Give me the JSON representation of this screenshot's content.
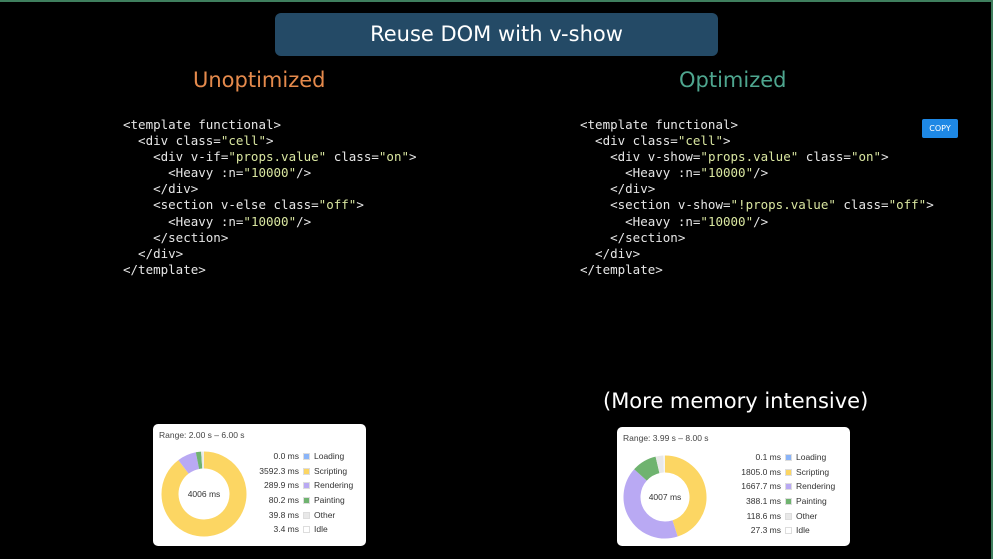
{
  "slide": {
    "title": "Reuse DOM with v-show",
    "left_heading": "Unoptimized",
    "right_heading": "Optimized",
    "copy_label": "COPY",
    "note": "(More memory intensive)"
  },
  "code_left": [
    "<template functional>",
    "  <div class=\"cell\">",
    "    <div v-if=\"props.value\" class=\"on\">",
    "      <Heavy :n=\"10000\"/>",
    "    </div>",
    "    <section v-else class=\"off\">",
    "      <Heavy :n=\"10000\"/>",
    "    </section>",
    "  </div>",
    "</template>"
  ],
  "code_right": [
    "<template functional>",
    "  <div class=\"cell\">",
    "    <div v-show=\"props.value\" class=\"on\">",
    "      <Heavy :n=\"10000\"/>",
    "    </div>",
    "    <section v-show=\"!props.value\" class=\"off\">",
    "      <Heavy :n=\"10000\"/>",
    "    </section>",
    "  </div>",
    "</template>"
  ],
  "perf_left": {
    "range": "Range: 2.00 s – 6.00 s",
    "total": "4006 ms",
    "rows": [
      {
        "value": "0.0 ms",
        "label": "Loading",
        "ms": 0.0,
        "color": "#8ab4f8"
      },
      {
        "value": "3592.3 ms",
        "label": "Scripting",
        "ms": 3592.3,
        "color": "#fcd663"
      },
      {
        "value": "289.9 ms",
        "label": "Rendering",
        "ms": 289.9,
        "color": "#b9a9f3"
      },
      {
        "value": "80.2 ms",
        "label": "Painting",
        "ms": 80.2,
        "color": "#6fb36f"
      },
      {
        "value": "39.8 ms",
        "label": "Other",
        "ms": 39.8,
        "color": "#e8e8e8"
      },
      {
        "value": "3.4 ms",
        "label": "Idle",
        "ms": 3.4,
        "color": "#ffffff"
      }
    ]
  },
  "perf_right": {
    "range": "Range: 3.99 s – 8.00 s",
    "total": "4007 ms",
    "rows": [
      {
        "value": "0.1 ms",
        "label": "Loading",
        "ms": 0.1,
        "color": "#8ab4f8"
      },
      {
        "value": "1805.0 ms",
        "label": "Scripting",
        "ms": 1805.0,
        "color": "#fcd663"
      },
      {
        "value": "1667.7 ms",
        "label": "Rendering",
        "ms": 1667.7,
        "color": "#b9a9f3"
      },
      {
        "value": "388.1 ms",
        "label": "Painting",
        "ms": 388.1,
        "color": "#6fb36f"
      },
      {
        "value": "118.6 ms",
        "label": "Other",
        "ms": 118.6,
        "color": "#e8e8e8"
      },
      {
        "value": "27.3 ms",
        "label": "Idle",
        "ms": 27.3,
        "color": "#ffffff"
      }
    ]
  }
}
